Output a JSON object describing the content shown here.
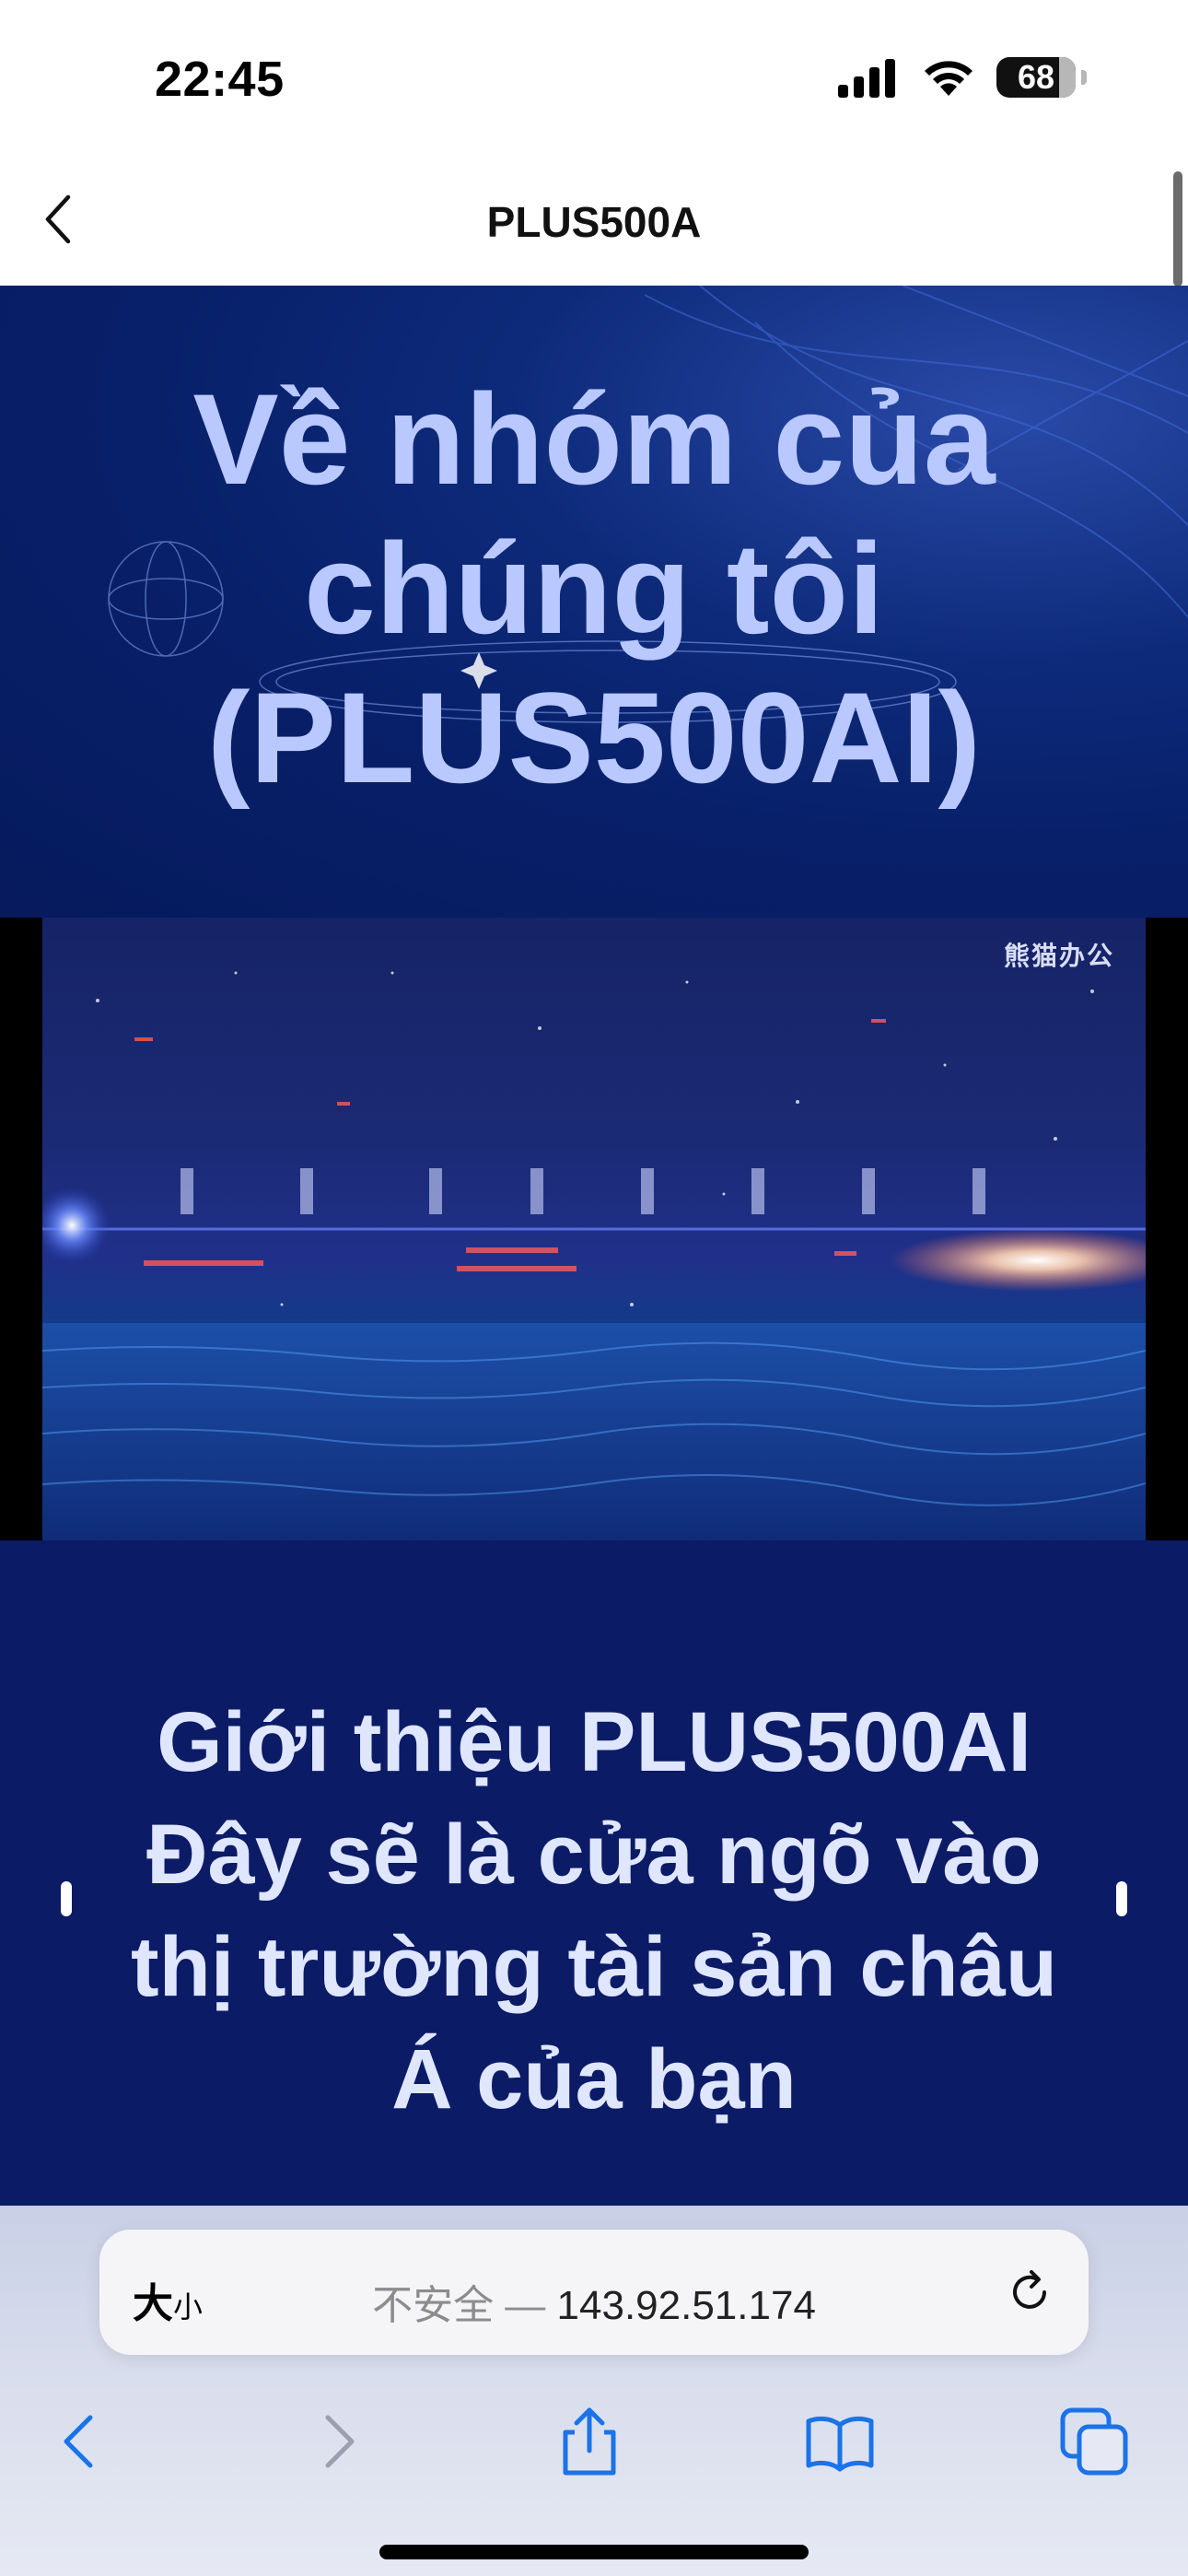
{
  "status_bar": {
    "time": "22:45",
    "battery": "68",
    "icons": [
      "signal-icon",
      "wifi-icon",
      "battery-icon"
    ]
  },
  "header": {
    "title": "PLUS500A",
    "back_icon": "chevron-left-icon"
  },
  "hero": {
    "heading_lines": [
      "Về nhóm của",
      "chúng tôi",
      "(PLUS500AI)"
    ]
  },
  "video": {
    "watermark": "熊猫办公"
  },
  "intro": {
    "lines": [
      "Giới thiệu PLUS500AI",
      "Đây sẽ là cửa ngõ vào",
      "thị trường tài sản châu",
      "Á của bạn"
    ]
  },
  "safari": {
    "text_size_label": "大",
    "text_size_small": "小",
    "insecure_label": "不安全 — ",
    "url": "143.92.51.174",
    "reload_icon": "reload-icon",
    "toolbar_icons": [
      "back-arrow-icon",
      "forward-arrow-icon",
      "share-icon",
      "bookmarks-icon",
      "tabs-icon"
    ]
  },
  "colors": {
    "hero_bg": "#0d2a7a",
    "heading": "#b9c8ff",
    "intro_bg": "#0b1b66",
    "accent_blue": "#1a73e8"
  }
}
